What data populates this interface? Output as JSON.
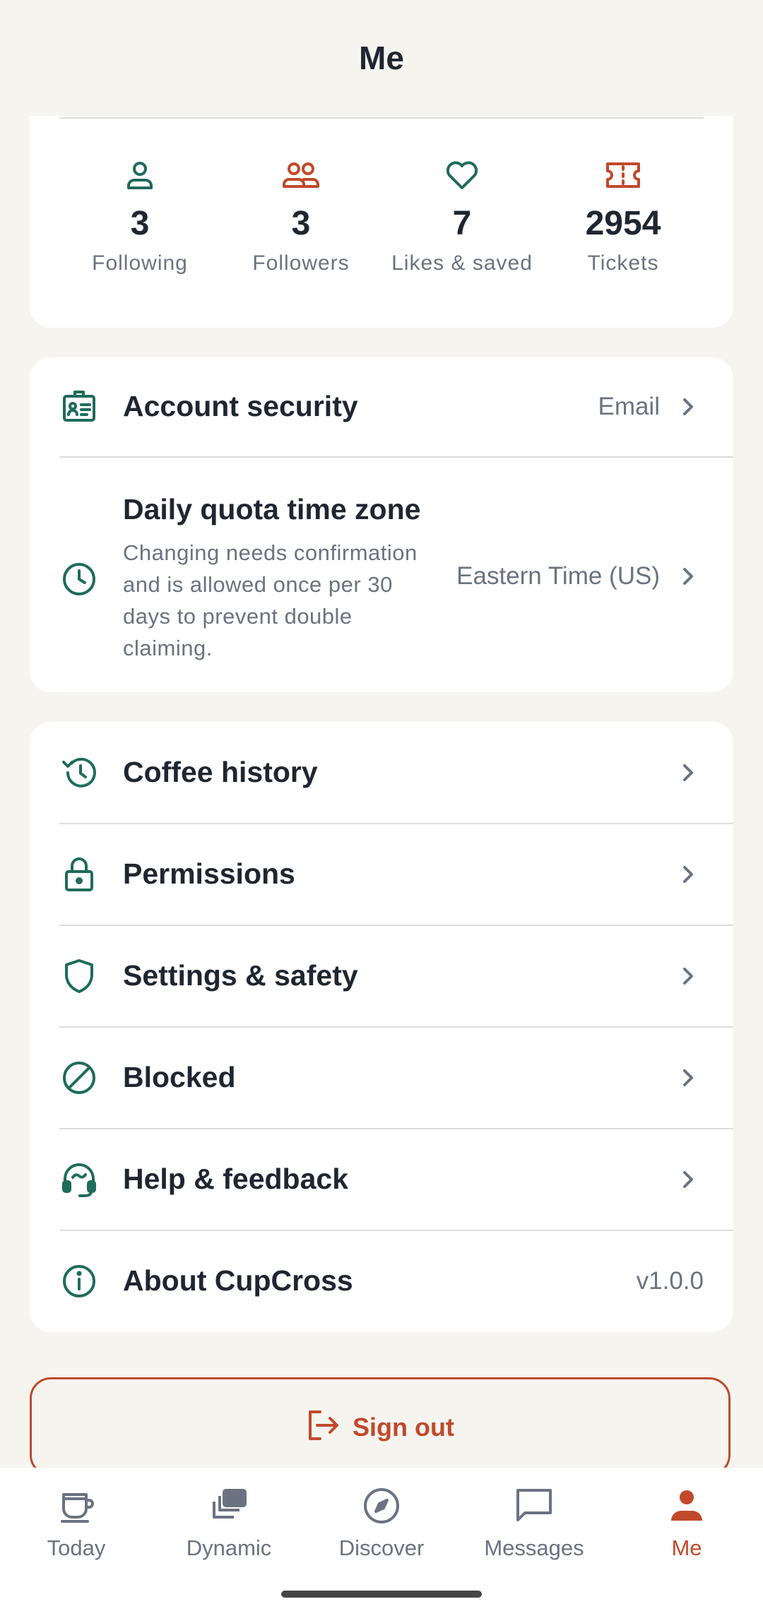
{
  "header": {
    "title": "Me"
  },
  "stats": [
    {
      "icon": "person-icon",
      "value": "3",
      "label": "Following"
    },
    {
      "icon": "people-icon",
      "value": "3",
      "label": "Followers"
    },
    {
      "icon": "heart-icon",
      "value": "7",
      "label": "Likes & saved"
    },
    {
      "icon": "ticket-icon",
      "value": "2954",
      "label": "Tickets"
    }
  ],
  "account": {
    "security": {
      "label": "Account security",
      "value": "Email"
    },
    "timezone": {
      "label": "Daily quota time zone",
      "description": "Changing needs confirmation and is allowed once per 30 days to prevent double claiming.",
      "value": "Eastern Time (US)"
    }
  },
  "menu": [
    {
      "icon": "history-icon",
      "label": "Coffee history"
    },
    {
      "icon": "lock-icon",
      "label": "Permissions"
    },
    {
      "icon": "shield-icon",
      "label": "Settings & safety"
    },
    {
      "icon": "blocked-icon",
      "label": "Blocked"
    },
    {
      "icon": "headset-icon",
      "label": "Help & feedback"
    },
    {
      "icon": "info-icon",
      "label": "About CupCross",
      "value": "v1.0.0"
    }
  ],
  "signout": {
    "label": "Sign out"
  },
  "nav": [
    {
      "icon": "coffee-cup-icon",
      "label": "Today",
      "active": false
    },
    {
      "icon": "stacked-cards-icon",
      "label": "Dynamic",
      "active": false
    },
    {
      "icon": "compass-icon",
      "label": "Discover",
      "active": false
    },
    {
      "icon": "chat-bubble-icon",
      "label": "Messages",
      "active": false
    },
    {
      "icon": "person-filled-icon",
      "label": "Me",
      "active": true
    }
  ],
  "colors": {
    "background": "#F5F4EF",
    "card": "#FFFFFF",
    "primary_green": "#1F6B5C",
    "accent_rust": "#C0492B",
    "text_dark": "#1F2630",
    "text_muted": "#6B7280"
  }
}
